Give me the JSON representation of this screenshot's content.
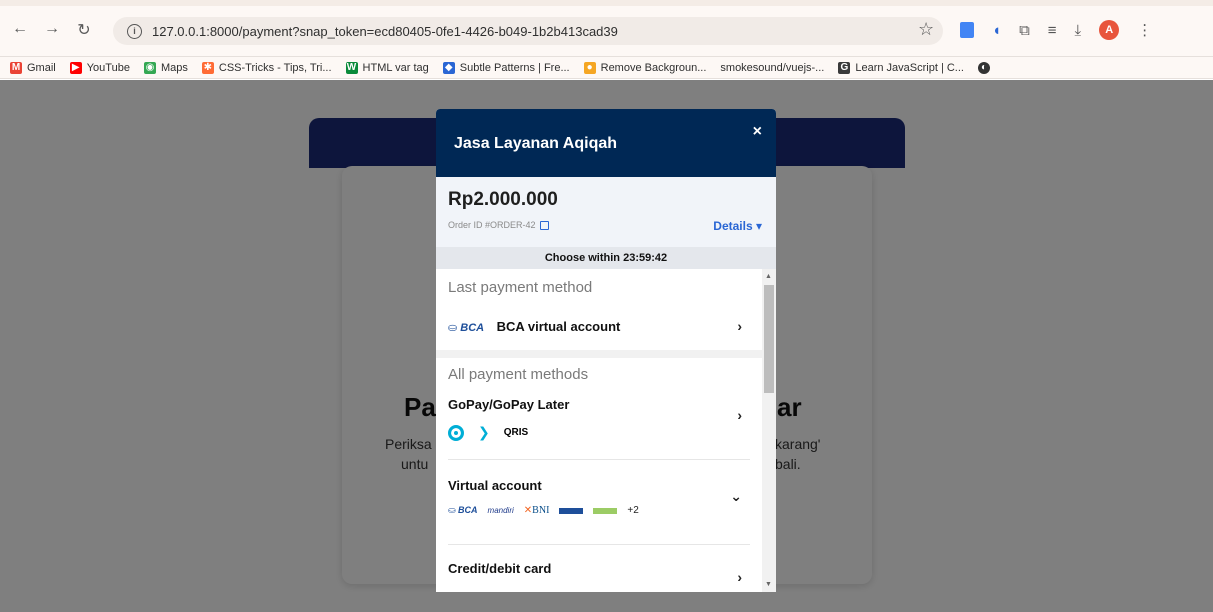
{
  "browser": {
    "url": "127.0.0.1:8000/payment?snap_token=ecd80405-0fe1-4426-b049-1b2b413cad39",
    "profile_initial": "A",
    "bookmarks": [
      {
        "label": "Gmail"
      },
      {
        "label": "YouTube"
      },
      {
        "label": "Maps"
      },
      {
        "label": "CSS-Tricks - Tips, Tri..."
      },
      {
        "label": "HTML var tag"
      },
      {
        "label": "Subtle Patterns | Fre..."
      },
      {
        "label": "Remove Backgroun..."
      },
      {
        "label": "smokesound/vuejs-..."
      },
      {
        "label": "Learn JavaScript | C..."
      }
    ]
  },
  "page": {
    "heading_left": "Pa",
    "heading_right": "ar",
    "line1_left": "Periksa",
    "line1_right": "karang'",
    "line2_left": "untu",
    "line2_right": "bali."
  },
  "modal": {
    "title": "Jasa Layanan Aqiqah",
    "close": "×",
    "amount": "Rp2.000.000",
    "order_id": "Order ID #ORDER-42",
    "details": "Details ▾",
    "timer": "Choose within 23:59:42",
    "last_section": "Last payment method",
    "last_method": "BCA virtual account",
    "all_section": "All payment methods",
    "methods": [
      {
        "title": "GoPay/GoPay Later"
      },
      {
        "title": "Virtual account",
        "more": "+2"
      },
      {
        "title": "Credit/debit card"
      }
    ],
    "bca_logo": "BCA",
    "mandiri_logo": "mandiri",
    "bni_logo": "BNI",
    "qris_logo": "QRIS"
  },
  "colors": {
    "modal_header": "#002855",
    "link": "#2a66d4",
    "nav_band": "#1b2a79"
  }
}
